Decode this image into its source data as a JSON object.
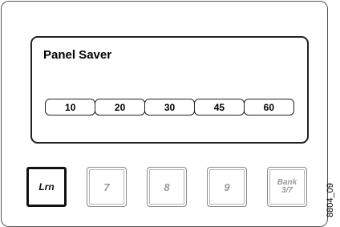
{
  "display": {
    "title": "Panel Saver",
    "options": [
      "10",
      "20",
      "30",
      "45",
      "60"
    ]
  },
  "keys": {
    "learn": "Lrn",
    "seven": "7",
    "eight": "8",
    "nine": "9",
    "bank": "Bank\n3/7"
  },
  "figure_id": "8804_09"
}
